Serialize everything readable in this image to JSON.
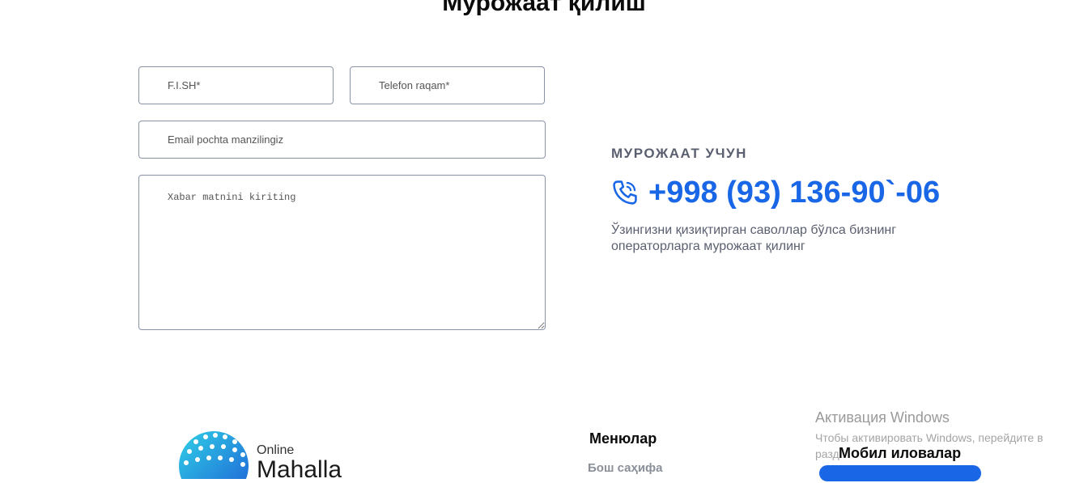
{
  "page": {
    "title": "Мурожаат қилиш"
  },
  "form": {
    "fio_placeholder": "F.I.SH*",
    "phone_placeholder": "Telefon raqam*",
    "email_placeholder": "Email pochta manzilingiz",
    "message_placeholder": "Xabar matnini kiriting"
  },
  "contact": {
    "heading": "МУРОЖААТ УЧУН",
    "phone": "+998 (93) 136-90`-06",
    "phone_icon": "phone-icon",
    "description": "Ўзингизни қизиқтирган саволлар бўлса бизнинг операторларга мурожаат қилинг",
    "accent_color": "#1967e6"
  },
  "footer": {
    "logo_online": "Online",
    "logo_mahalla": "Mahalla",
    "menu_title": "Менюлар",
    "menu_first_item": "Бош саҳифа",
    "apps_title": "Мобил иловалар"
  },
  "windows_overlay": {
    "title": "Активация Windows",
    "line1": "Чтобы активировать Windows, перейдите в",
    "line2": "разд"
  }
}
